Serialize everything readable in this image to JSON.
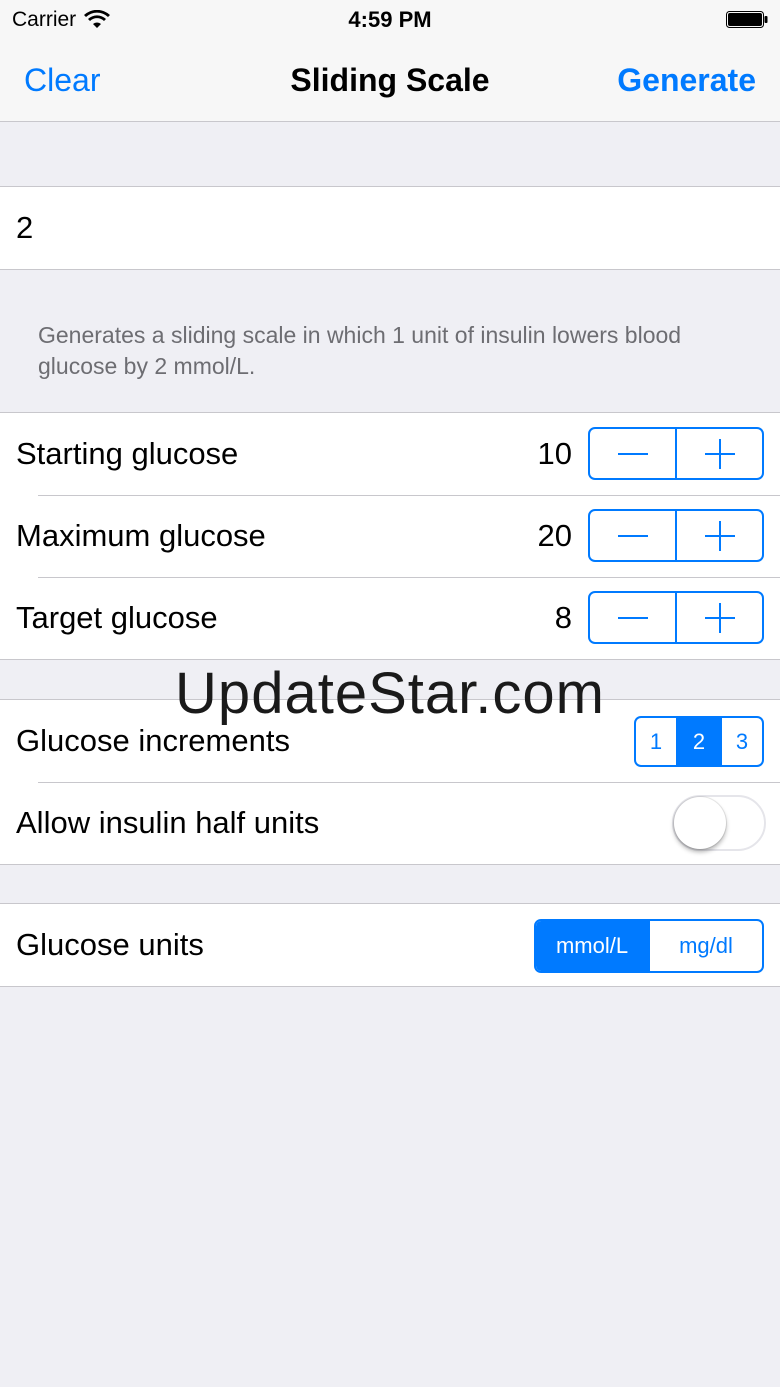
{
  "status_bar": {
    "carrier": "Carrier",
    "time": "4:59 PM",
    "wifi_icon": "wifi-icon",
    "battery_icon": "battery-icon"
  },
  "nav": {
    "left": "Clear",
    "title": "Sliding Scale",
    "right": "Generate"
  },
  "input": {
    "value": "2"
  },
  "footer": "Generates a sliding scale in which 1 unit of insulin lowers blood glucose by 2 mmol/L.",
  "steppers": [
    {
      "label": "Starting glucose",
      "value": "10"
    },
    {
      "label": "Maximum glucose",
      "value": "20"
    },
    {
      "label": "Target glucose",
      "value": "8"
    }
  ],
  "increments": {
    "label": "Glucose increments",
    "options": [
      "1",
      "2",
      "3"
    ],
    "selected": "2"
  },
  "half_units": {
    "label": "Allow insulin half units",
    "on": false
  },
  "units": {
    "label": "Glucose units",
    "options": [
      "mmol/L",
      "mg/dl"
    ],
    "selected": "mmol/L"
  },
  "watermark": "UpdateStar.com",
  "colors": {
    "accent": "#007aff",
    "background": "#efeff4",
    "separator": "#c8c7cc"
  }
}
